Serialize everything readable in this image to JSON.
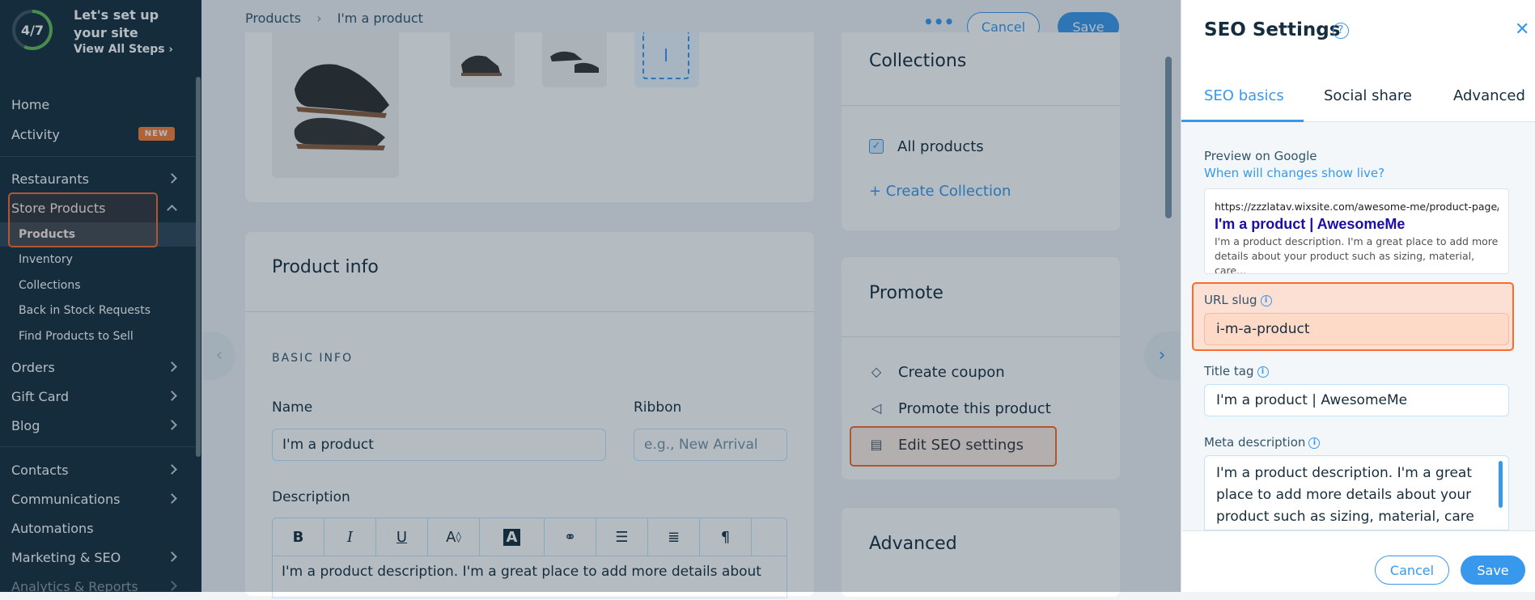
{
  "sidebar": {
    "progress": {
      "text": "4/7",
      "fraction": 0.57
    },
    "setup_title": "Let's set up your site",
    "setup_link": "View All Steps",
    "items": {
      "home": "Home",
      "activity": "Activity",
      "activity_badge": "NEW",
      "restaurants": "Restaurants",
      "store_products": "Store Products",
      "products": "Products",
      "inventory": "Inventory",
      "collections": "Collections",
      "back_in_stock": "Back in Stock Requests",
      "find_products": "Find Products to Sell",
      "orders": "Orders",
      "gift_card": "Gift Card",
      "blog": "Blog",
      "contacts": "Contacts",
      "communications": "Communications",
      "automations": "Automations",
      "marketing_seo": "Marketing & SEO",
      "analytics": "Analytics & Reports"
    }
  },
  "header": {
    "breadcrumb_root": "Products",
    "breadcrumb_current": "I'm a product",
    "more_icon": "ellipsis-icon",
    "cancel_label": "Cancel",
    "save_label": "Save"
  },
  "collections_card": {
    "title": "Collections",
    "checkbox_label": "All products",
    "checked": true,
    "create_link": "+ Create Collection"
  },
  "product_info": {
    "title": "Product info",
    "section_label": "BASIC INFO",
    "name_label": "Name",
    "name_value": "I'm a product",
    "ribbon_label": "Ribbon",
    "ribbon_placeholder": "e.g., New Arrival",
    "description_label": "Description",
    "description_text": "I'm a product description. I'm a great place to add more details about",
    "toolbar": [
      "B",
      "I",
      "U",
      "A",
      "A",
      "link",
      "bullets",
      "numbers",
      "paragraph"
    ]
  },
  "promote_card": {
    "title": "Promote",
    "items": [
      "Create coupon",
      "Promote this product",
      "Edit SEO settings"
    ]
  },
  "advanced_card": {
    "title": "Advanced"
  },
  "seo_panel": {
    "title": "SEO Settings",
    "tabs": [
      "SEO basics",
      "Social share",
      "Advanced"
    ],
    "active_tab": "SEO basics",
    "preview_label": "Preview on Google",
    "preview_link": "When will changes show live?",
    "google_preview": {
      "url": "https://zzzlatav.wixsite.com/awesome-me/product-page/...",
      "title": "I'm a product | AwesomeMe",
      "description": "I'm a product description. I'm a great place to add more details about your product such as sizing, material, care..."
    },
    "url_slug_label": "URL slug",
    "url_slug_value": "i-m-a-product",
    "title_tag_label": "Title tag",
    "title_tag_value": "I'm a product | AwesomeMe",
    "meta_label": "Meta description",
    "meta_value": "I'm a product description. I'm a great place to add more details about your product such as sizing, material, care",
    "cancel_label": "Cancel",
    "save_label": "Save"
  },
  "colors": {
    "sidebar_bg": "#162d3d",
    "accent": "#3899ec",
    "highlight": "#fa6b2c",
    "badge": "#fb7d33",
    "progress": "#60bc57"
  }
}
